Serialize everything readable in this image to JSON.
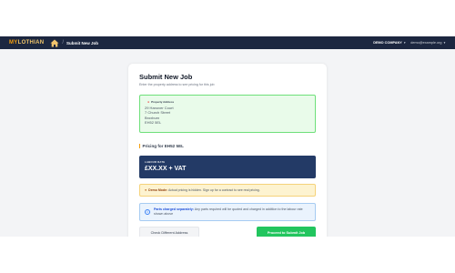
{
  "nav": {
    "brand_prefix": "MY",
    "brand_rest": "LOTHIAN",
    "breadcrumb": "Submit New Job",
    "company": "DEMO COMPANY",
    "user_email": "demo@example.org"
  },
  "card": {
    "title": "Submit New Job",
    "subtitle": "Enter the property address to see pricing for this job",
    "address_label": "Property Address",
    "address_lines": [
      "29 Hanover Court",
      "7 Church Street",
      "Broxburn",
      "EH52 5EL"
    ]
  },
  "pricing": {
    "label": "Pricing for EH52 5EL",
    "rate_label": "LABOUR RATE",
    "rate_value": "£XX.XX + VAT"
  },
  "demo_notice": {
    "title": "Demo Mode:",
    "text": "Actual pricing is hidden. Sign up for a contract to see real pricing."
  },
  "parts_notice": {
    "title": "Parts charged separately:",
    "text": "Any parts required will be quoted and charged in addition to the labour rate shown above"
  },
  "buttons": {
    "check_address": "Check Different Address",
    "proceed": "Proceed to Submit Job"
  },
  "colors": {
    "nav_bg": "#1c2740",
    "accent": "#f59e0b",
    "rate_bg": "#233a66",
    "success": "#22c55e"
  }
}
